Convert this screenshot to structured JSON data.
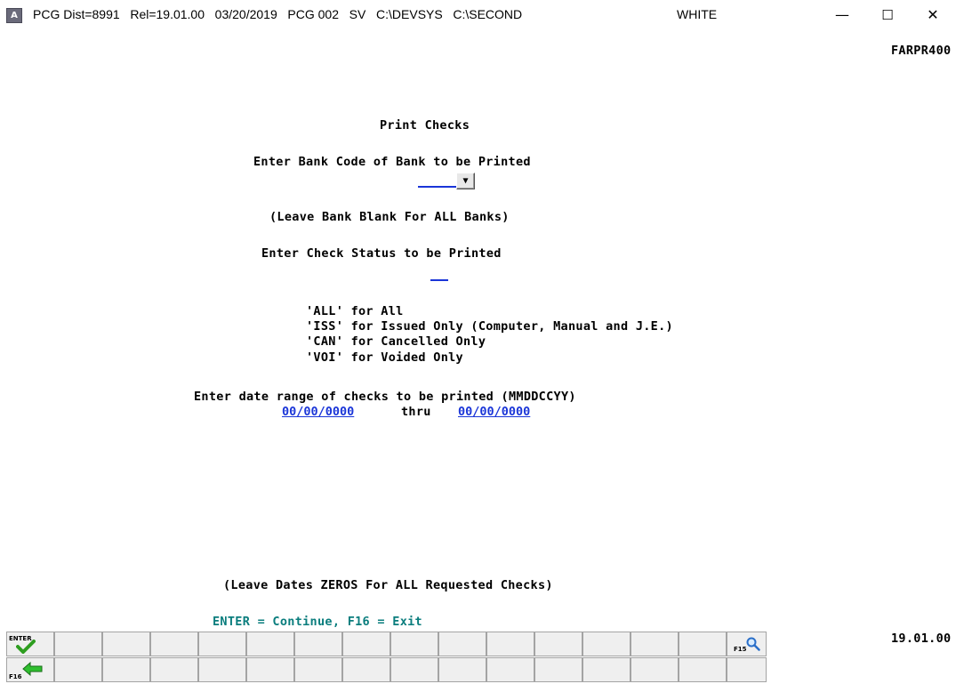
{
  "window": {
    "title": "PCG Dist=8991   Rel=19.01.00   03/20/2019   PCG 002   SV   C:\\DEVSYS   C:\\SECOND",
    "user": "WHITE",
    "minimize": "—",
    "maximize": "☐",
    "close": "✕"
  },
  "program_id": "FARPR400",
  "screen": {
    "title": "Print Checks",
    "bank_prompt": "Enter Bank Code of Bank to be Printed",
    "bank_note": "(Leave Bank Blank For ALL Banks)",
    "status_prompt": "Enter Check Status to be Printed",
    "status_options": [
      "'ALL' for All",
      "'ISS' for Issued Only (Computer, Manual and J.E.)",
      "'CAN' for Cancelled Only",
      "'VOI' for Voided Only"
    ],
    "date_prompt": "Enter date range of checks to be printed (MMDDCCYY)",
    "date_from": "00/00/0000",
    "thru": "thru",
    "date_to": "00/00/0000",
    "date_note": "(Leave Dates ZEROS For ALL Requested Checks)",
    "key_help": "ENTER = Continue, F16 = Exit"
  },
  "fkeys": {
    "enter_label": "ENTER",
    "f15_label": "F15",
    "f16_label": "F16"
  },
  "version": "19.01.00",
  "colors": {
    "field_blue": "#1a35d8",
    "help_teal": "#0a7d7d",
    "enter_green": "#2e9e20"
  }
}
